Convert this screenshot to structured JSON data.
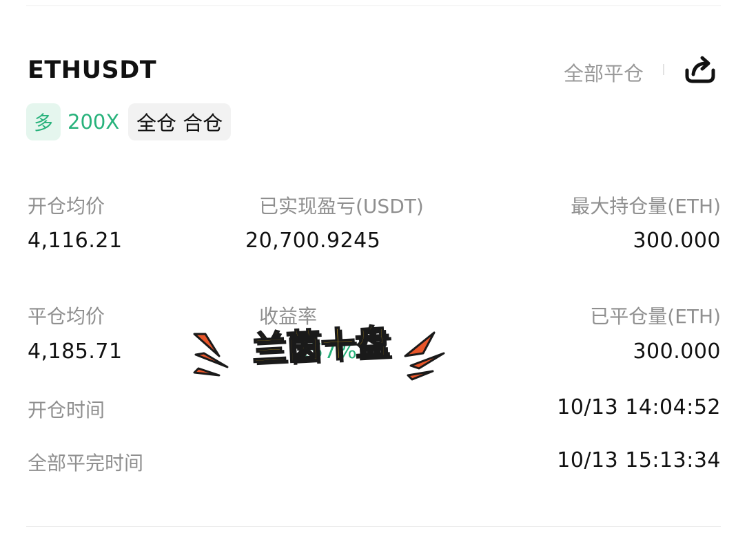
{
  "header": {
    "symbol": "ETHUSDT",
    "close_all_label": "全部平仓"
  },
  "tags": {
    "direction": "多",
    "leverage": "200X",
    "margin_mode": "全仓 合仓"
  },
  "stats": {
    "open_avg_price": {
      "label": "开仓均价",
      "value": "4,116.21"
    },
    "realized_pnl": {
      "label": "已实现盈亏(USDT)",
      "value": "20,700.9245"
    },
    "max_position": {
      "label": "最大持仓量(ETH)",
      "value": "300.000"
    },
    "close_avg_price": {
      "label": "平仓均价",
      "value": "4,185.71"
    },
    "yield_rate": {
      "label": "收益率",
      "value": ".57%"
    },
    "closed_position": {
      "label": "已平仓量(ETH)",
      "value": "300.000"
    },
    "open_time": {
      "label": "开仓时间",
      "value": "10/13 14:04:52"
    },
    "close_complete_time": {
      "label": "全部平完时间",
      "value": "10/13 15:13:34"
    }
  },
  "sticker": {
    "text": "兰茵十盘"
  },
  "colors": {
    "accent_green": "#27b27b",
    "tag_green_bg": "#e5f6ee",
    "muted_text": "#8f8f8f",
    "sticker_yellow": "#f7c21b",
    "sticker_orange": "#e8562a"
  }
}
